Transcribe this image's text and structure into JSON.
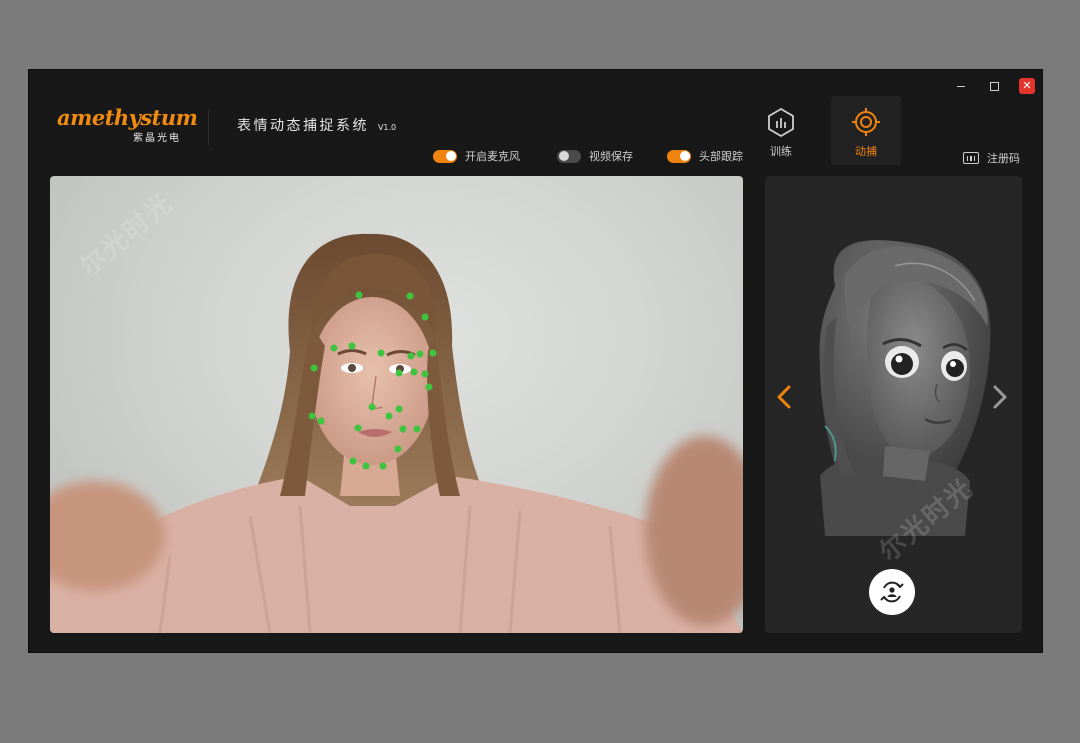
{
  "app": {
    "logo_text": "amethystum",
    "logo_sub": "紫晶光电",
    "title": "表情动态捕捉系统",
    "version": "V1.0"
  },
  "window_controls": {
    "close_glyph": "✕"
  },
  "toggles": [
    {
      "label": "开启麦克风",
      "state": "on"
    },
    {
      "label": "视频保存",
      "state": "off"
    },
    {
      "label": "头部跟踪",
      "state": "on"
    }
  ],
  "nav": {
    "train_label": "训练",
    "mocap_label": "动捕",
    "active": "动捕"
  },
  "register_label": "注册码",
  "watermark_text": "尔光时光",
  "colors": {
    "accent": "#f0820f",
    "window_bg": "#181818",
    "panel_bg": "#262626",
    "close": "#e2352e",
    "landmark": "#3ec43e"
  },
  "icons": {
    "train": "hexagon-bar-chart-icon",
    "mocap": "crosshair-target-icon",
    "register": "keyboard-icon",
    "prev": "chevron-left-icon",
    "next": "chevron-right-icon",
    "switch_camera": "switch-person-icon"
  }
}
